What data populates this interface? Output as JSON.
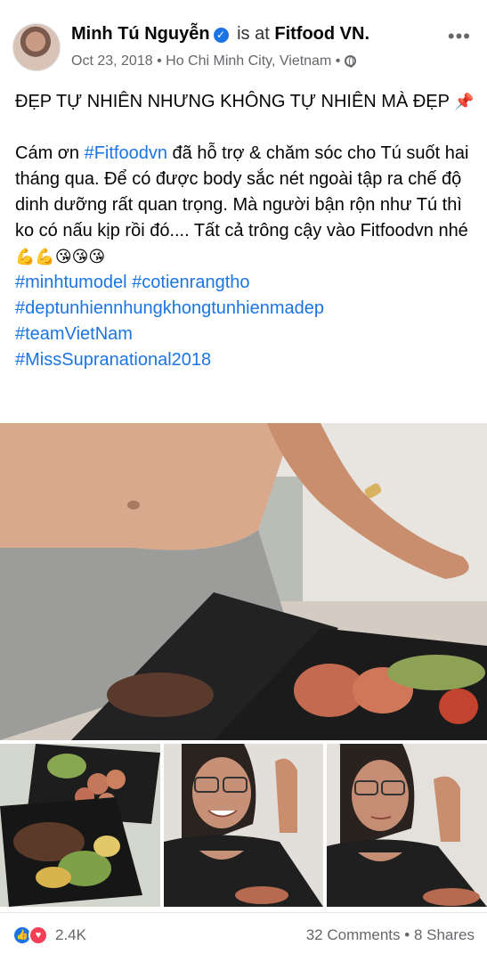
{
  "post": {
    "author_name": "Minh Tú Nguyễn",
    "checkin_text": "is at",
    "place": "Fitfood VN.",
    "date": "Oct 23, 2018",
    "location": "Ho Chi Minh City, Vietnam",
    "separator": "•",
    "more_label": "•••",
    "verified_glyph": "✓",
    "headline": "ĐẸP TỰ NHIÊN NHƯNG KHÔNG TỰ NHIÊN MÀ ĐẸP",
    "headline_emoji": "📌",
    "body_intro": "Cám ơn ",
    "body_tag": "#Fitfoodvn",
    "body_rest": " đã hỗ trợ & chăm sóc cho Tú suốt hai tháng qua. Để có được body sắc nét ngoài tập ra chế độ dinh dưỡng rất quan trọng. Mà người bận rộn như Tú thì ko có nấu kịp rồi đó.... Tất cả trông cậy vào Fitfoodvn nhé ",
    "body_emojis": "💪💪😘😘😘",
    "hashtags": [
      "#minhtumodel #cotienrangtho",
      "#deptunhiennhungkhongtunhienmadep",
      "#teamVietNam",
      "#MissSupranational2018"
    ]
  },
  "reactions": {
    "count": "2.4K",
    "like_glyph": "👍",
    "love_glyph": "♥",
    "comments": "32 Comments",
    "shares": "8 Shares",
    "dot": "•"
  },
  "icons": {
    "verified": "verified-badge-icon",
    "privacy": "globe-icon",
    "more": "more-options-icon",
    "like": "like-reaction-icon",
    "love": "love-reaction-icon"
  },
  "colors": {
    "link_blue": "#1b74e4",
    "meta_gray": "#65676b",
    "love_red": "#f33e58"
  }
}
